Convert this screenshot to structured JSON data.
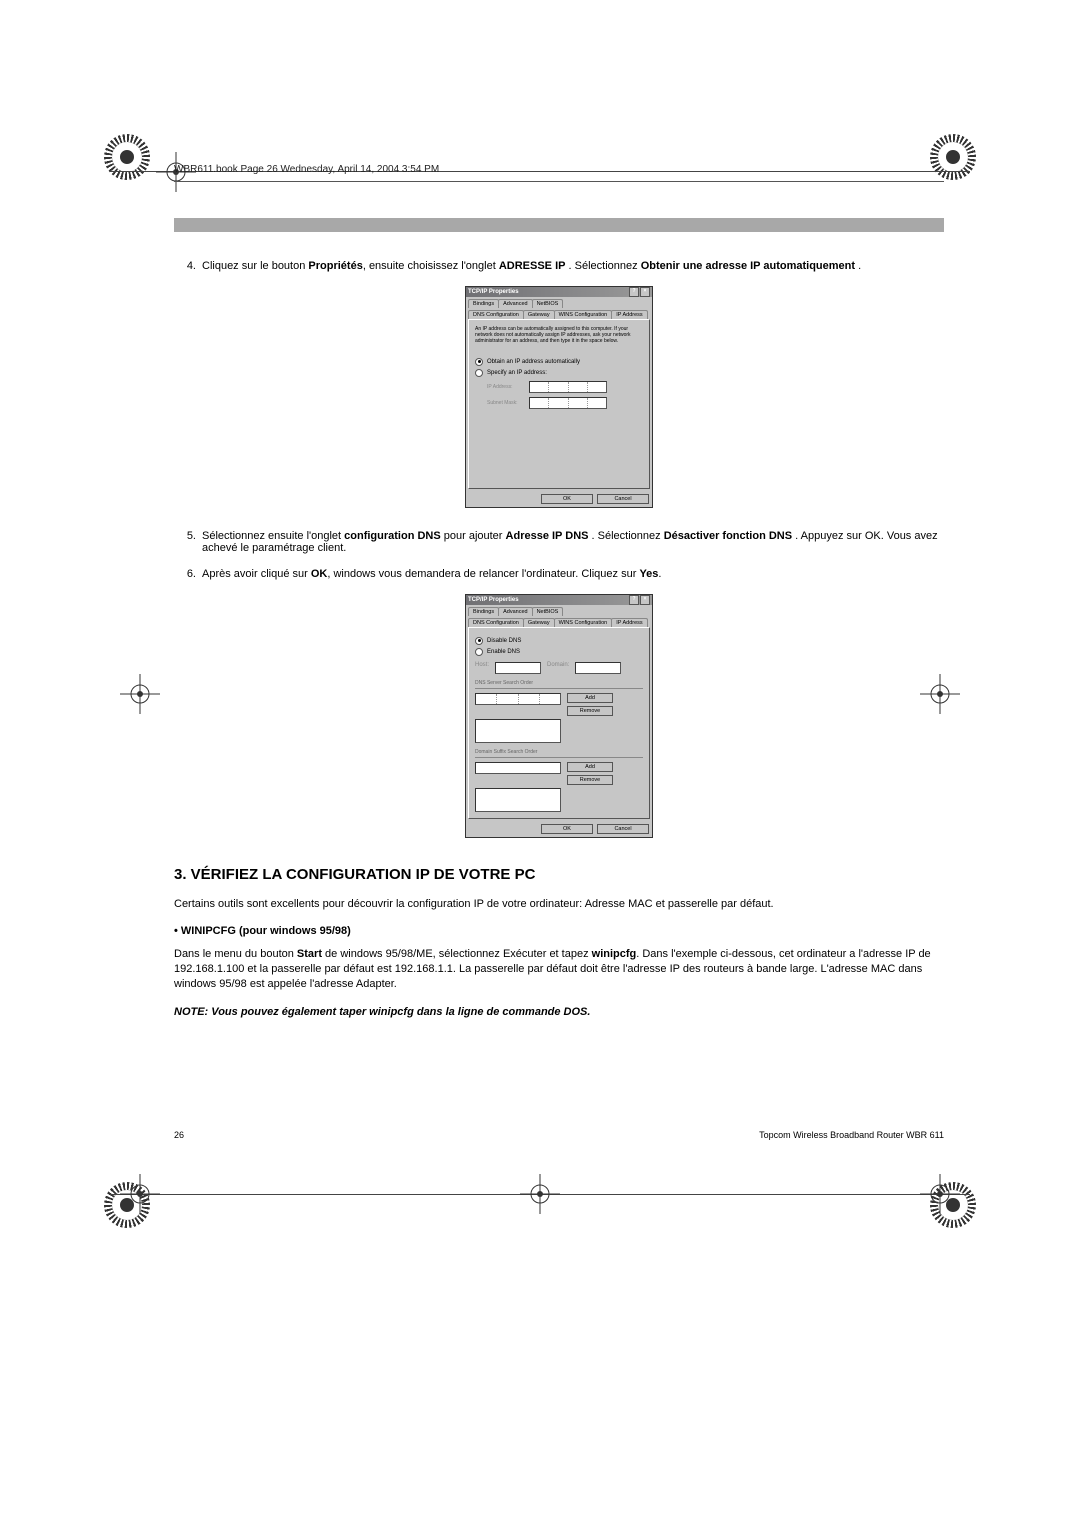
{
  "meta": {
    "headerline": "WBR611.book  Page 26  Wednesday, April 14, 2004  3:54 PM"
  },
  "steps": {
    "s4_num": "4.",
    "s4_a": "Cliquez sur le bouton ",
    "s4_b": "Propriétés",
    "s4_c": ", ensuite choisissez l'onglet ",
    "s4_d": "ADRESSE IP",
    "s4_e": " . Sélectionnez ",
    "s4_f": "Obtenir une adresse IP automatiquement",
    "s4_g": " .",
    "s5_num": "5.",
    "s5_a": "Sélectionnez ensuite l'onglet  ",
    "s5_b": "configuration DNS",
    "s5_c": "  pour ajouter ",
    "s5_d": "Adresse IP DNS",
    "s5_e": " . Sélectionnez ",
    "s5_f": "Désactiver fonction DNS",
    "s5_g": " . Appuyez sur OK.  Vous avez achevé le paramétrage client.",
    "s6_num": "6.",
    "s6_a": "Après avoir cliqué sur ",
    "s6_b": "OK",
    "s6_c": ", windows vous demandera de relancer l'ordinateur. Cliquez sur ",
    "s6_d": "Yes",
    "s6_e": "."
  },
  "dialog1": {
    "title": "TCP/IP Properties",
    "tabs_row1": [
      "Bindings",
      "Advanced",
      "NetBIOS"
    ],
    "tabs_row2": [
      "DNS Configuration",
      "Gateway",
      "WINS Configuration",
      "IP Address"
    ],
    "help": "An IP address can be automatically assigned to this computer. If your network does not automatically assign IP addresses, ask your network administrator for an address, and then type it in the space below.",
    "radio_auto": "Obtain an IP address automatically",
    "radio_specify": "Specify an IP address:",
    "ip_label": "IP Address:",
    "mask_label": "Subnet Mask:",
    "ok": "OK",
    "cancel": "Cancel"
  },
  "dialog2": {
    "title": "TCP/IP Properties",
    "tabs_row1": [
      "Bindings",
      "Advanced",
      "NetBIOS"
    ],
    "tabs_row2": [
      "DNS Configuration",
      "Gateway",
      "WINS Configuration",
      "IP Address"
    ],
    "radio_disable": "Disable DNS",
    "radio_enable": "Enable DNS",
    "host": "Host:",
    "domain": "Domain:",
    "search_order": "DNS Server Search Order",
    "suffix_order": "Domain Suffix Search Order",
    "add": "Add",
    "remove": "Remove",
    "ok": "OK",
    "cancel": "Cancel"
  },
  "section": {
    "heading": "3.   VÉRIFIEZ LA CONFIGURATION IP  DE VOTRE PC",
    "p1": "Certains outils sont excellents pour découvrir la configuration IP de votre ordinateur: Adresse MAC et passerelle par défaut.",
    "bullet": "• WINIPCFG (pour windows 95/98)",
    "p2_a": "Dans le menu du bouton ",
    "p2_b": "Start",
    "p2_c": " de windows 95/98/ME, sélectionnez Exécuter et tapez ",
    "p2_d": "winipcfg",
    "p2_e": ". Dans l'exemple ci-dessous, cet ordinateur a l'adresse IP de 192.168.1.100 et la passerelle par défaut est 192.168.1.1.  La passerelle par défaut doit être l'adresse IP des routeurs à bande large. L'adresse MAC dans windows 95/98 est appelée l'adresse Adapter.",
    "note": "NOTE: Vous pouvez également taper winipcfg dans la ligne de commande DOS."
  },
  "footer": {
    "page": "26",
    "product": "Topcom Wireless Broadband Router WBR 611"
  }
}
